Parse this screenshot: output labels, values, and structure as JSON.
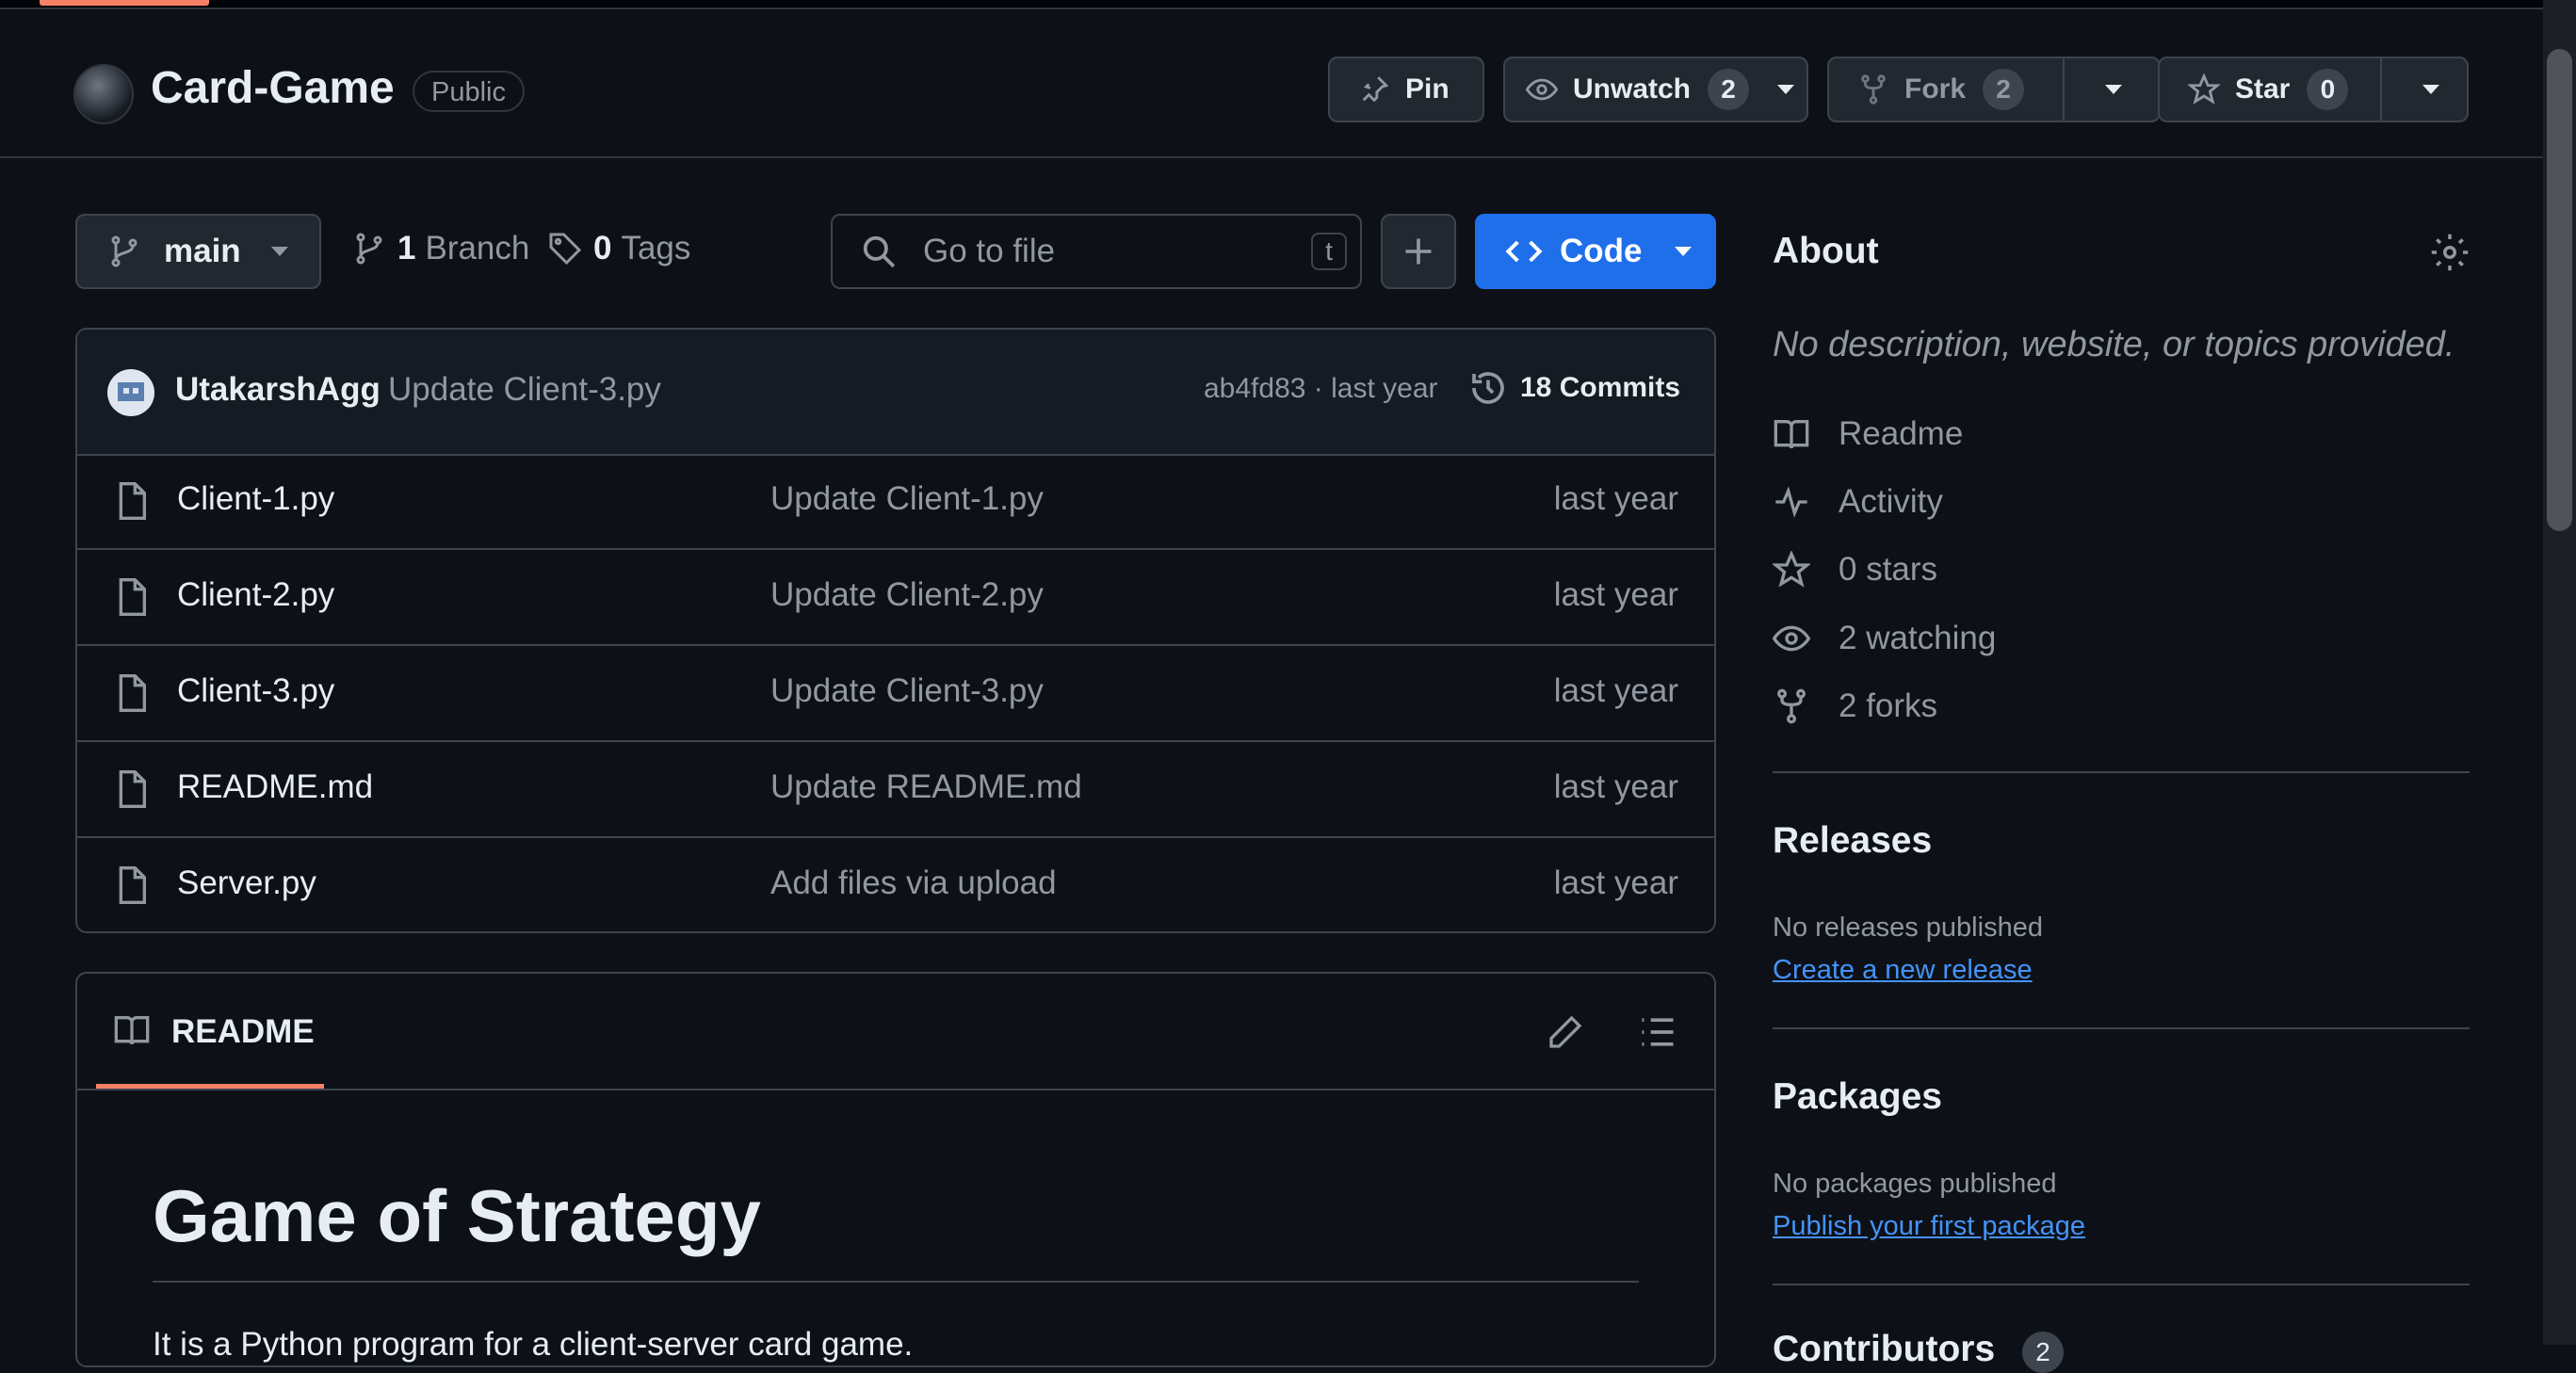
{
  "repo": {
    "name": "Card-Game",
    "visibility": "Public"
  },
  "actions": {
    "pin_label": "Pin",
    "watch_label": "Unwatch",
    "watch_count": "2",
    "fork_label": "Fork",
    "fork_count": "2",
    "star_label": "Star",
    "star_count": "0"
  },
  "toolbar": {
    "branch": "main",
    "branches_count": "1",
    "branches_label": "Branch",
    "tags_count": "0",
    "tags_label": "Tags",
    "search_placeholder": "Go to file",
    "search_shortcut": "t",
    "code_label": "Code"
  },
  "latest_commit": {
    "author": "UtakarshAgg",
    "message": "Update Client-3.py",
    "hash": "ab4fd83",
    "time": "last year",
    "commits_label": "18 Commits"
  },
  "files": [
    {
      "name": "Client-1.py",
      "message": "Update Client-1.py",
      "time": "last year"
    },
    {
      "name": "Client-2.py",
      "message": "Update Client-2.py",
      "time": "last year"
    },
    {
      "name": "Client-3.py",
      "message": "Update Client-3.py",
      "time": "last year"
    },
    {
      "name": "README.md",
      "message": "Update README.md",
      "time": "last year"
    },
    {
      "name": "Server.py",
      "message": "Add files via upload",
      "time": "last year"
    }
  ],
  "readme": {
    "tab_label": "README",
    "heading": "Game of Strategy",
    "intro": "It is a Python program for a client-server card game."
  },
  "about": {
    "title": "About",
    "description": "No description, website, or topics provided.",
    "links": {
      "readme": "Readme",
      "activity": "Activity",
      "stars": "0 stars",
      "watching": "2 watching",
      "forks": "2 forks"
    }
  },
  "releases": {
    "title": "Releases",
    "empty": "No releases published",
    "action": "Create a new release"
  },
  "packages": {
    "title": "Packages",
    "empty": "No packages published",
    "action": "Publish your first package"
  },
  "contributors": {
    "title": "Contributors",
    "count": "2"
  },
  "colors": {
    "accent": "#f78166",
    "primary_button": "#1f6feb",
    "link": "#4493f8",
    "background": "#0d1117"
  }
}
